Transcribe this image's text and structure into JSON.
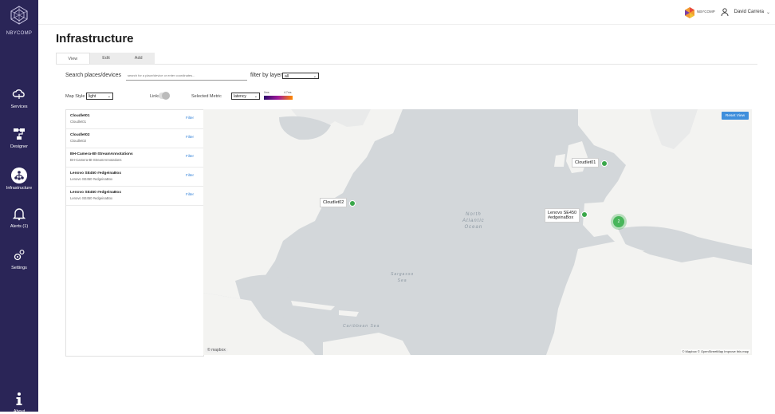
{
  "sidebar": {
    "logo_text": "NBYCOMP",
    "items": [
      {
        "label": "Services"
      },
      {
        "label": "Designer"
      },
      {
        "label": "Infrastructure"
      },
      {
        "label": "Alerts (1)"
      },
      {
        "label": "Settings"
      },
      {
        "label": "About"
      }
    ]
  },
  "topbar": {
    "brand": "NBYCOMP",
    "user_name": "David Carrera",
    "user_chevron": "⌄"
  },
  "page": {
    "title": "Infrastructure",
    "tabs": [
      {
        "label": "View",
        "active": true
      },
      {
        "label": "Edit",
        "active": false
      },
      {
        "label": "Add",
        "active": false
      }
    ]
  },
  "search": {
    "label": "Search places/devices",
    "placeholder": "search for a place/device or enter coordinates...",
    "filter_label": "filter by layer",
    "filter_value": "all"
  },
  "controls": {
    "map_style_label": "Map Style",
    "map_style_value": "light",
    "links_label": "Links",
    "links_enabled": false,
    "metric_label": "Selected Metric",
    "metric_value": "latency",
    "legend_low": "0ms",
    "legend_high": "4.7ms",
    "legend_colors": [
      "#2d0a6b",
      "#a11b9a",
      "#ff8a00"
    ]
  },
  "devices": [
    {
      "name": "Cloudlet01",
      "sub": "Cloudlet01",
      "action": "Filter"
    },
    {
      "name": "Cloudlet02",
      "sub": "Cloudlet02",
      "action": "Filter"
    },
    {
      "name": "BH-Camera-Bt-StreamAnnotations",
      "sub": "BH-Camera-Bt-StreamAnnotations",
      "action": "Filter"
    },
    {
      "name": "Lenovo SE450 #edgeinaBox",
      "sub": "Lenovo SE450 #edgeinaBox",
      "action": "Filter"
    },
    {
      "name": "Lenovo SE450 #edgeinaBox",
      "sub": "Lenovo SE450 #edgeinaBox",
      "action": "Filter"
    }
  ],
  "map": {
    "reset_label": "Reset View",
    "markers": [
      {
        "label": "Cloudlet01"
      },
      {
        "label": "Cloudlet02"
      },
      {
        "label": "Lenovo SE450\n#edgeinaBox"
      }
    ],
    "cluster_count": "2",
    "ocean_label": "North\nAtlantic\nOcean",
    "sea_label": "Sargasso\nSea",
    "caribbean_label": "Caribbean Sea",
    "mapbox_label": "© mapbox",
    "attribution": "© Mapbox © OpenStreetMap Improve this map",
    "marker_color": "#3aa74a"
  }
}
